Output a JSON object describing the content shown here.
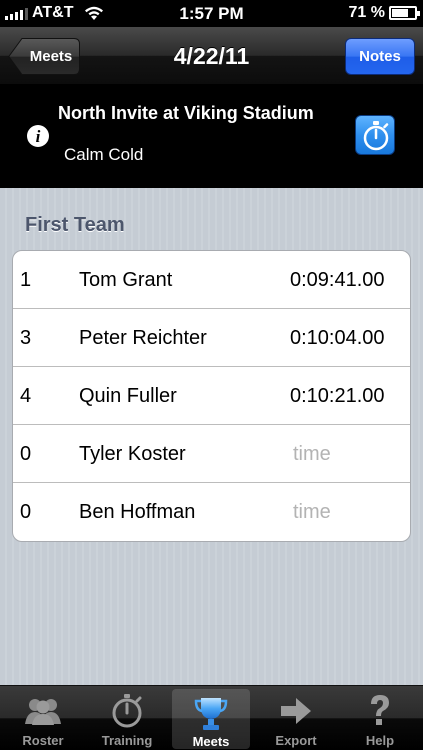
{
  "status_bar": {
    "carrier": "AT&T",
    "time": "1:57 PM",
    "battery_percent": "71 %",
    "battery_level": 0.71
  },
  "nav": {
    "back_label": "Meets",
    "title": "4/22/11",
    "notes_label": "Notes"
  },
  "meet": {
    "name": "North Invite at Viking Stadium",
    "weather": "Calm Cold"
  },
  "section": {
    "title": "First Team"
  },
  "results": [
    {
      "place": "1",
      "name": "Tom Grant",
      "time": "0:09:41.00"
    },
    {
      "place": "3",
      "name": "Peter Reichter",
      "time": "0:10:04.00"
    },
    {
      "place": "4",
      "name": "Quin Fuller",
      "time": "0:10:21.00"
    },
    {
      "place": "0",
      "name": "Tyler Koster",
      "time": "time"
    },
    {
      "place": "0",
      "name": "Ben Hoffman",
      "time": "time"
    }
  ],
  "tabs": [
    {
      "label": "Roster",
      "icon": "roster-icon"
    },
    {
      "label": "Training",
      "icon": "stopwatch-icon"
    },
    {
      "label": "Meets",
      "icon": "trophy-icon",
      "active": true
    },
    {
      "label": "Export",
      "icon": "arrow-right-icon"
    },
    {
      "label": "Help",
      "icon": "question-icon"
    }
  ],
  "colors": {
    "notes_button": "#2466ef",
    "section_title": "#4c566c",
    "placeholder": "#b3b3b3"
  }
}
